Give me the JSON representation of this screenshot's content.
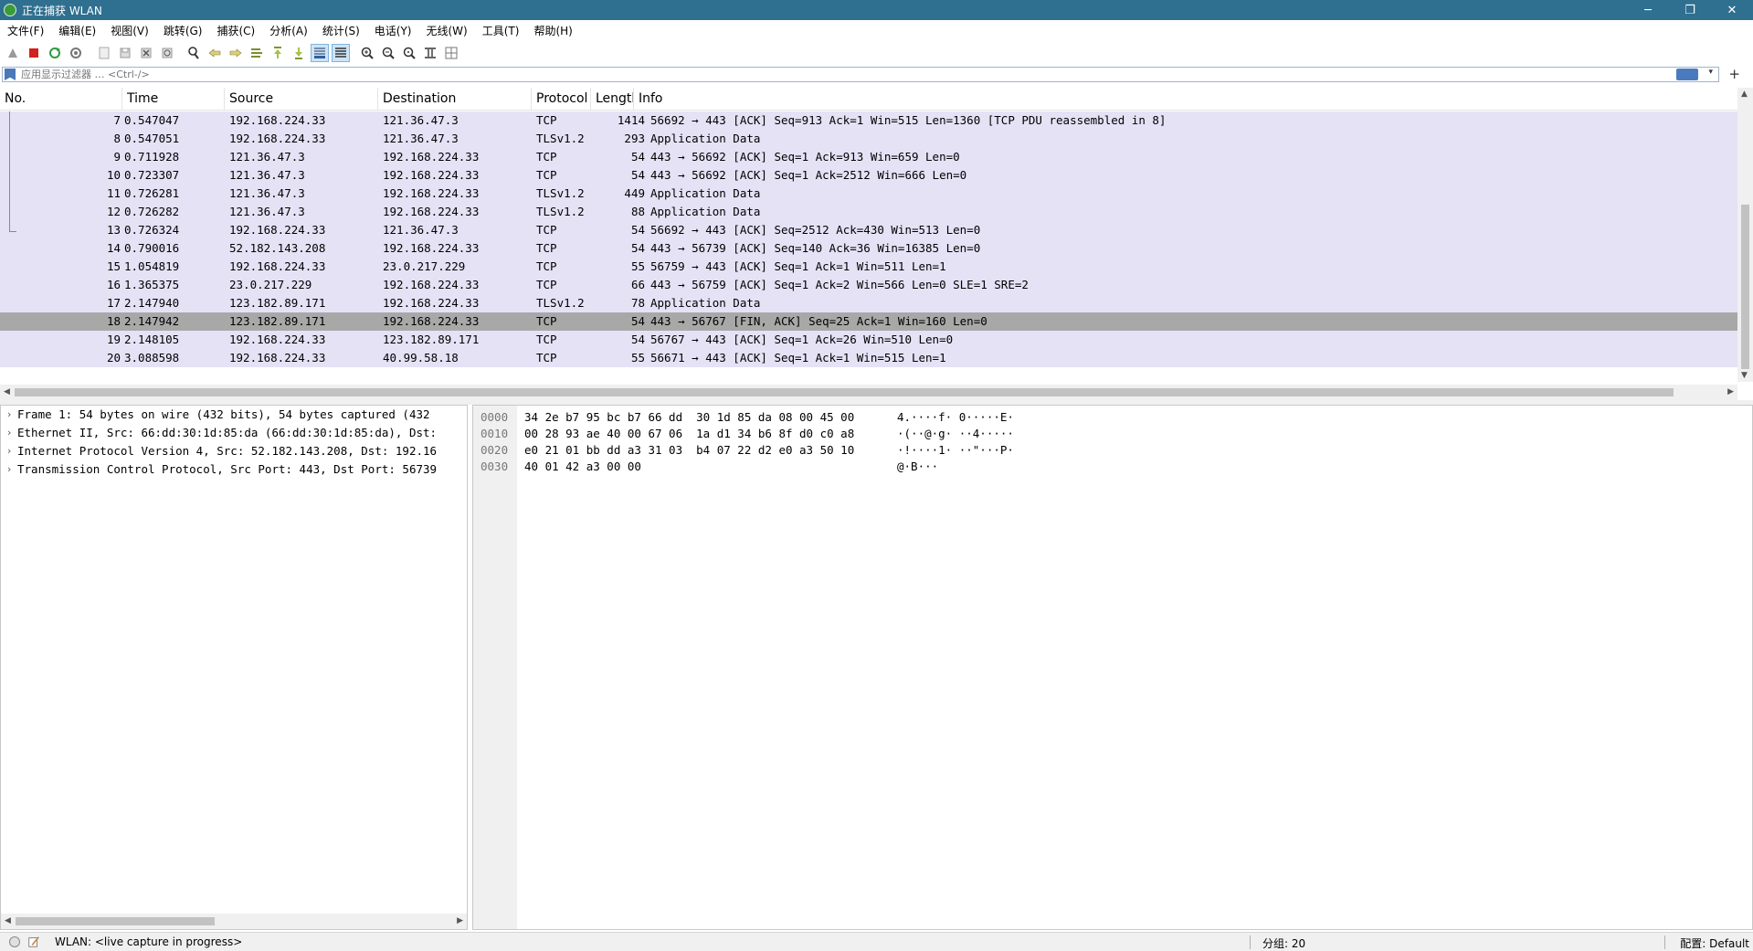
{
  "window": {
    "title": "正在捕获 WLAN",
    "controls": [
      "─",
      "❐",
      "✕"
    ]
  },
  "menu": [
    "文件(F)",
    "编辑(E)",
    "视图(V)",
    "跳转(G)",
    "捕获(C)",
    "分析(A)",
    "统计(S)",
    "电话(Y)",
    "无线(W)",
    "工具(T)",
    "帮助(H)"
  ],
  "toolbar": [
    "start-capture-icon",
    "stop-capture-icon",
    "restart-capture-icon",
    "capture-options-icon",
    "open-file-icon",
    "save-file-icon",
    "close-file-icon",
    "reload-file-icon",
    "find-packet-icon",
    "go-back-icon",
    "go-forward-icon",
    "go-to-packet-icon",
    "first-packet-icon",
    "last-packet-icon",
    "auto-scroll-icon",
    "colorize-icon",
    "zoom-in-icon",
    "zoom-out-icon",
    "normal-size-icon",
    "resize-columns-icon",
    "layout-icon"
  ],
  "filter": {
    "placeholder": "应用显示过滤器 … <Ctrl-/>",
    "add": "+"
  },
  "packet_list": {
    "columns": [
      "No.",
      "Time",
      "Source",
      "Destination",
      "Protocol",
      "Length",
      "Info"
    ],
    "rows": [
      {
        "no": "7",
        "time": "0.547047",
        "src": "192.168.224.33",
        "dst": "121.36.47.3",
        "proto": "TCP",
        "len": "1414",
        "info": "56692 → 443 [ACK] Seq=913 Ack=1 Win=515 Len=1360 [TCP PDU reassembled in 8]"
      },
      {
        "no": "8",
        "time": "0.547051",
        "src": "192.168.224.33",
        "dst": "121.36.47.3",
        "proto": "TLSv1.2",
        "len": "293",
        "info": "Application Data"
      },
      {
        "no": "9",
        "time": "0.711928",
        "src": "121.36.47.3",
        "dst": "192.168.224.33",
        "proto": "TCP",
        "len": "54",
        "info": "443 → 56692 [ACK] Seq=1 Ack=913 Win=659 Len=0"
      },
      {
        "no": "10",
        "time": "0.723307",
        "src": "121.36.47.3",
        "dst": "192.168.224.33",
        "proto": "TCP",
        "len": "54",
        "info": "443 → 56692 [ACK] Seq=1 Ack=2512 Win=666 Len=0"
      },
      {
        "no": "11",
        "time": "0.726281",
        "src": "121.36.47.3",
        "dst": "192.168.224.33",
        "proto": "TLSv1.2",
        "len": "449",
        "info": "Application Data"
      },
      {
        "no": "12",
        "time": "0.726282",
        "src": "121.36.47.3",
        "dst": "192.168.224.33",
        "proto": "TLSv1.2",
        "len": "88",
        "info": "Application Data"
      },
      {
        "no": "13",
        "time": "0.726324",
        "src": "192.168.224.33",
        "dst": "121.36.47.3",
        "proto": "TCP",
        "len": "54",
        "info": "56692 → 443 [ACK] Seq=2512 Ack=430 Win=513 Len=0"
      },
      {
        "no": "14",
        "time": "0.790016",
        "src": "52.182.143.208",
        "dst": "192.168.224.33",
        "proto": "TCP",
        "len": "54",
        "info": "443 → 56739 [ACK] Seq=140 Ack=36 Win=16385 Len=0"
      },
      {
        "no": "15",
        "time": "1.054819",
        "src": "192.168.224.33",
        "dst": "23.0.217.229",
        "proto": "TCP",
        "len": "55",
        "info": "56759 → 443 [ACK] Seq=1 Ack=1 Win=511 Len=1"
      },
      {
        "no": "16",
        "time": "1.365375",
        "src": "23.0.217.229",
        "dst": "192.168.224.33",
        "proto": "TCP",
        "len": "66",
        "info": "443 → 56759 [ACK] Seq=1 Ack=2 Win=566 Len=0 SLE=1 SRE=2"
      },
      {
        "no": "17",
        "time": "2.147940",
        "src": "123.182.89.171",
        "dst": "192.168.224.33",
        "proto": "TLSv1.2",
        "len": "78",
        "info": "Application Data"
      },
      {
        "no": "18",
        "time": "2.147942",
        "src": "123.182.89.171",
        "dst": "192.168.224.33",
        "proto": "TCP",
        "len": "54",
        "info": "443 → 56767 [FIN, ACK] Seq=25 Ack=1 Win=160 Len=0"
      },
      {
        "no": "19",
        "time": "2.148105",
        "src": "192.168.224.33",
        "dst": "123.182.89.171",
        "proto": "TCP",
        "len": "54",
        "info": "56767 → 443 [ACK] Seq=1 Ack=26 Win=510 Len=0"
      },
      {
        "no": "20",
        "time": "3.088598",
        "src": "192.168.224.33",
        "dst": "40.99.58.18",
        "proto": "TCP",
        "len": "55",
        "info": "56671 → 443 [ACK] Seq=1 Ack=1 Win=515 Len=1"
      }
    ],
    "selected_index": 11
  },
  "details": [
    "Frame 1: 54 bytes on wire (432 bits), 54 bytes captured (432",
    "Ethernet II, Src: 66:dd:30:1d:85:da (66:dd:30:1d:85:da), Dst:",
    "Internet Protocol Version 4, Src: 52.182.143.208, Dst: 192.16",
    "Transmission Control Protocol, Src Port: 443, Dst Port: 56739"
  ],
  "bytes": [
    {
      "offset": "0000",
      "hex": "34 2e b7 95 bc b7 66 dd  30 1d 85 da 08 00 45 00",
      "ascii": "4.····f· 0·····E·"
    },
    {
      "offset": "0010",
      "hex": "00 28 93 ae 40 00 67 06  1a d1 34 b6 8f d0 c0 a8",
      "ascii": "·(··@·g· ··4·····"
    },
    {
      "offset": "0020",
      "hex": "e0 21 01 bb dd a3 31 03  b4 07 22 d2 e0 a3 50 10",
      "ascii": "·!····1· ··\"···P·"
    },
    {
      "offset": "0030",
      "hex": "40 01 42 a3 00 00",
      "ascii": "@·B···"
    }
  ],
  "status": {
    "capture": "WLAN: <live capture in progress>",
    "packets": "分组: 20",
    "profile": "配置: Default"
  },
  "colors": {
    "titlebar": "#2f6f8f",
    "row": "#e5e2f6",
    "selected": "#a8a8a8"
  }
}
